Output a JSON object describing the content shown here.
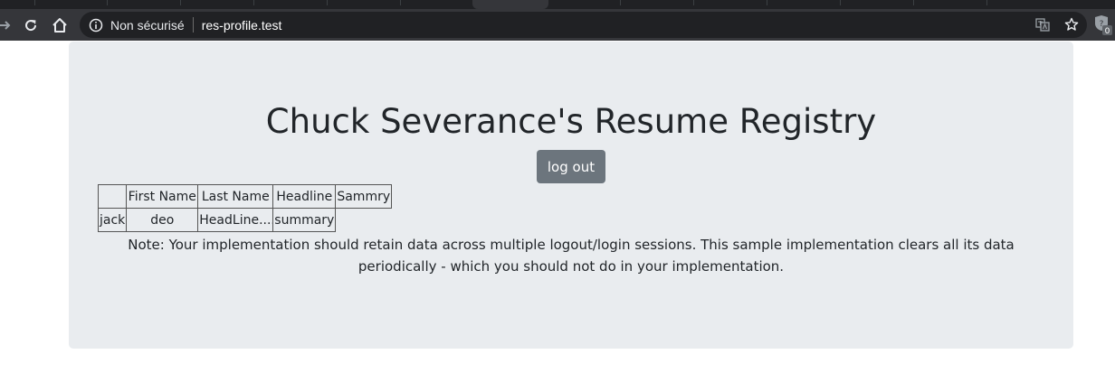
{
  "browser": {
    "security_label": "Non sécurisé",
    "url": "res-profile.test",
    "extension_badge": "0"
  },
  "page": {
    "title": "Chuck Severance's Resume Registry",
    "logout_label": "log out",
    "table": {
      "headers": [
        "",
        "First Name",
        "Last Name",
        "Headline",
        "Sammry"
      ],
      "rows": [
        [
          "jack",
          "deo",
          "HeadLine....",
          "summary"
        ]
      ]
    },
    "note": "Note: Your implementation should retain data across multiple logout/login sessions. This sample implementation clears all its data periodically - which you should not do in your implementation."
  },
  "icons": {
    "back": "arrow-right-icon",
    "reload": "reload-icon",
    "home": "home-icon",
    "info": "info-icon",
    "translate": "translate-icon",
    "bookmark": "star-icon",
    "extension": "extension-icon"
  },
  "colors": {
    "chrome_dark": "#202124",
    "toolbar": "#35363a",
    "jumbotron": "#e9ecef",
    "logout_button": "#6c757d",
    "text": "#212529"
  }
}
